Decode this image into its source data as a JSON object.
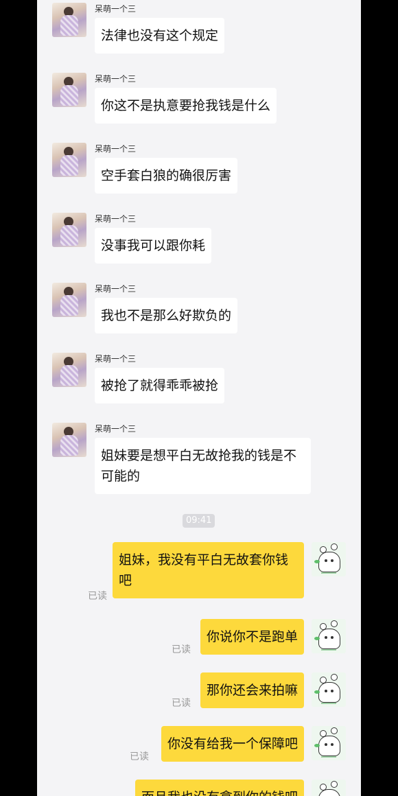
{
  "incoming": [
    {
      "sender": "呆萌一个三",
      "text": "法律也没有这个规定"
    },
    {
      "sender": "呆萌一个三",
      "text": "你这不是执意要抢我钱是什么"
    },
    {
      "sender": "呆萌一个三",
      "text": "空手套白狼的确很厉害"
    },
    {
      "sender": "呆萌一个三",
      "text": "没事我可以跟你耗"
    },
    {
      "sender": "呆萌一个三",
      "text": "我也不是那么好欺负的"
    },
    {
      "sender": "呆萌一个三",
      "text": "被抢了就得乖乖被抢"
    },
    {
      "sender": "呆萌一个三",
      "text": "姐妹要是想平白无故抢我的钱是不可能的"
    }
  ],
  "timestamp": "09:41",
  "outgoing": [
    {
      "text": "姐妹，我没有平白无故套你钱吧",
      "status": "已读"
    },
    {
      "text": "你说你不是跑单",
      "status": "已读"
    },
    {
      "text": "那你还会来拍嘛",
      "status": "已读"
    },
    {
      "text": "你没有给我一个保障吧",
      "status": "已读"
    },
    {
      "text": "而且我也没有拿到你的钱吧",
      "status": ""
    }
  ],
  "colors": {
    "outgoing_bubble": "#fdd93c",
    "incoming_bubble": "#ffffff",
    "background": "#f4f4f6"
  },
  "icons": {
    "incoming_avatar": "avatar-photo",
    "outgoing_avatar": "avatar-cartoon"
  }
}
